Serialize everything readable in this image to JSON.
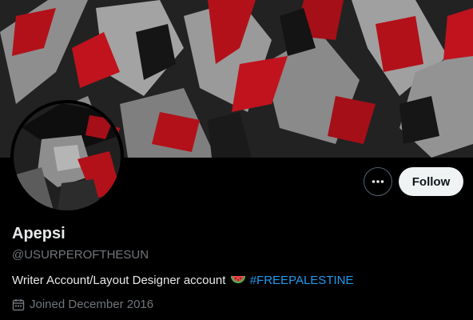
{
  "profile": {
    "display_name": "Apepsi",
    "handle": "@USURPEROFTHESUN",
    "bio_text": "Writer Account/Layout Designer account",
    "bio_emoji": "watermelon-icon",
    "bio_hashtag": "#FREEPALESTINE",
    "joined": "Joined December 2016"
  },
  "actions": {
    "follow_label": "Follow",
    "more_icon": "more-dots-icon"
  },
  "colors": {
    "background": "#000000",
    "text_primary": "#e7e9ea",
    "text_secondary": "#71767b",
    "link": "#1d9bf0",
    "follow_bg": "#eff3f4",
    "banner_red": "#b3111a",
    "banner_gray": "#9a9a9a"
  }
}
